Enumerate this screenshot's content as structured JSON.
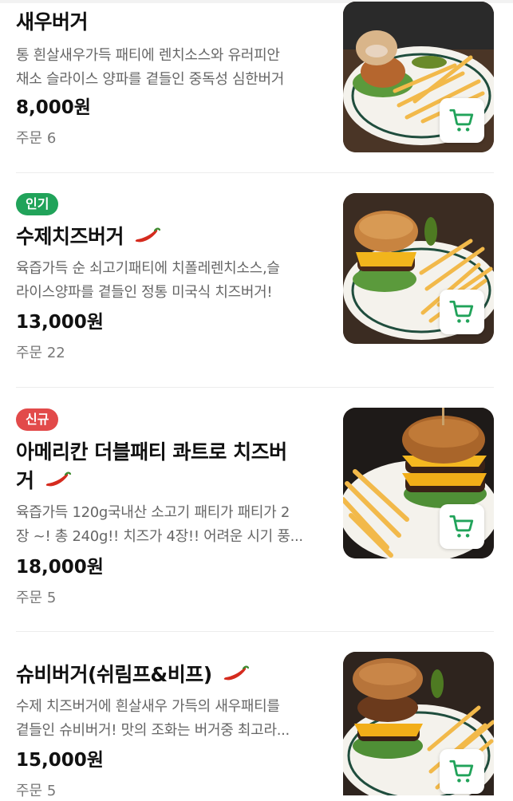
{
  "accent_color": "#21a35a",
  "items": [
    {
      "name": "새우버거",
      "spicy": false,
      "badge": "",
      "description_lines": [
        "통 흰살새우가득 패티에 렌치소스와 유러피안",
        "채소 슬라이스 양파를 곁들인 중독성 심한버거"
      ],
      "price": "8,000원",
      "orders": "주문 6",
      "image_icon": "shrimp-burger-photo",
      "cart_icon": "cart-icon"
    },
    {
      "name": "수제치즈버거",
      "spicy": true,
      "badge": "인기",
      "badge_color": "#21a35a",
      "description_lines": [
        "육즙가득 순 쇠고기패티에 치폴레렌치소스,슬",
        "라이스양파를 곁들인 정통 미국식 치즈버거!"
      ],
      "price": "13,000원",
      "orders": "주문 22",
      "image_icon": "cheese-burger-photo",
      "cart_icon": "cart-icon"
    },
    {
      "name_lines": [
        "아메리칸 더블패티 콰트로 치즈버",
        "거"
      ],
      "spicy": true,
      "badge": "신규",
      "badge_color": "#e24a4a",
      "description_lines": [
        "육즙가득 120g국내산 소고기 패티가 패티가 2",
        "장 ~! 총 240g!! 치즈가 4장!! 어려운 시기 풍..."
      ],
      "price": "18,000원",
      "orders": "주문 5",
      "image_icon": "double-patty-burger-photo",
      "cart_icon": "cart-icon"
    },
    {
      "name": "슈비버거(쉬림프&비프)",
      "spicy": true,
      "badge": "",
      "description_lines": [
        "수제 치즈버거에 흰살새우 가득의 새우패티를",
        "곁들인 슈비버거! 맛의 조화는 버거중 최고라..."
      ],
      "price": "15,000원",
      "orders": "주문 5",
      "image_icon": "shrimp-beef-burger-photo",
      "cart_icon": "cart-icon"
    }
  ]
}
